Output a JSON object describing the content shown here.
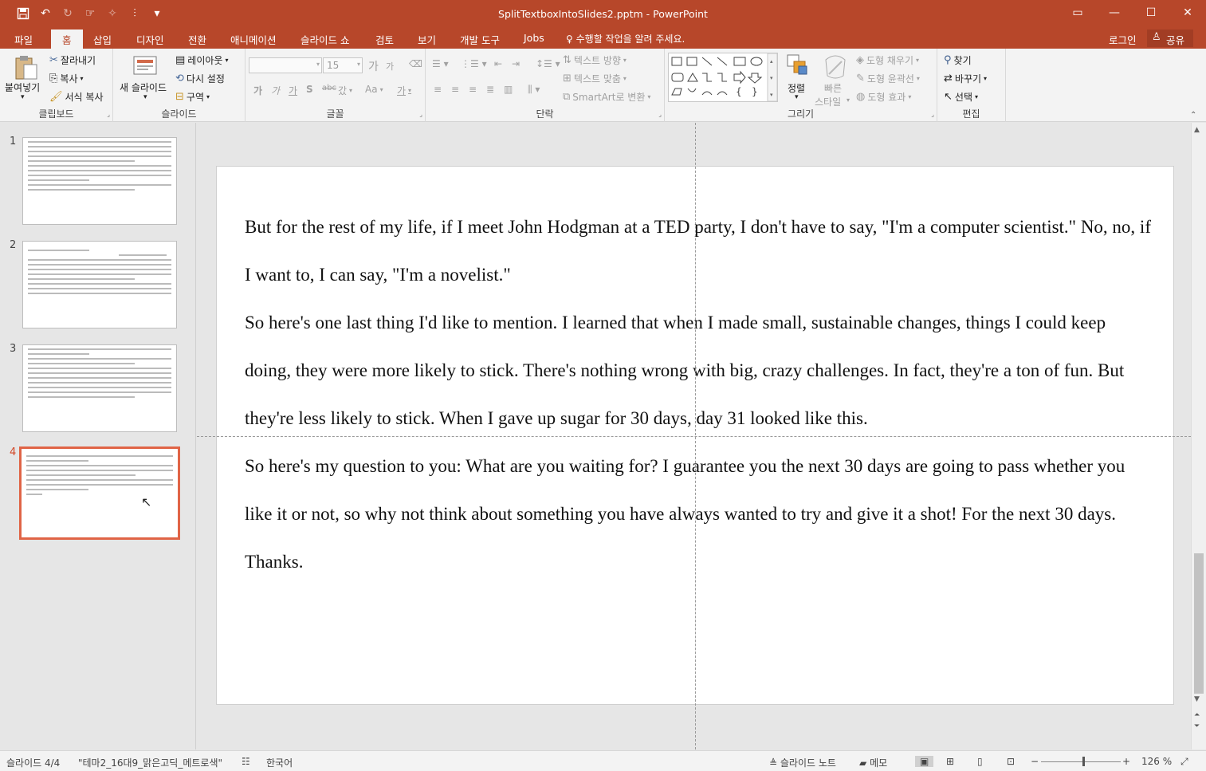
{
  "window": {
    "title": "SplitTextboxIntoSlides2.pptm - PowerPoint",
    "controls": [
      "ribbon-display-icon",
      "minimize-icon",
      "maximize-icon",
      "close-icon"
    ]
  },
  "quick_access": [
    "save-icon",
    "undo-icon",
    "redo-icon",
    "customize-icon"
  ],
  "tabs": [
    "파일",
    "홈",
    "삽입",
    "디자인",
    "전환",
    "애니메이션",
    "슬라이드 쇼",
    "검토",
    "보기",
    "개발 도구",
    "Jobs"
  ],
  "active_tab": "홈",
  "tell_me": "수행할 작업을 알려 주세요.",
  "login": "로그인",
  "share": "공유",
  "ribbon": {
    "clipboard": {
      "label": "클립보드",
      "paste": "붙여넣기",
      "cut": "잘라내기",
      "copy": "복사",
      "format_painter": "서식 복사"
    },
    "slides": {
      "label": "슬라이드",
      "new_slide": "새 슬라이드",
      "layout": "레이아웃",
      "reset": "다시 설정",
      "section": "구역"
    },
    "font": {
      "label": "글꼴",
      "font_name": "",
      "font_size": "15",
      "grow": "가",
      "shrink": "가",
      "bold": "가",
      "italic": "가",
      "underline": "가",
      "shadow": "S",
      "strike": "abc",
      "spacing": "갔",
      "case": "Aa",
      "color": "가"
    },
    "paragraph": {
      "label": "단락",
      "text_direction": "텍스트 방향",
      "align_text": "텍스트 맞춤",
      "smartart": "SmartArt로 변환"
    },
    "drawing": {
      "label": "그리기",
      "arrange": "정렬",
      "quick_styles_1": "빠른",
      "quick_styles_2": "스타일",
      "shape_fill": "도형 채우기",
      "shape_outline": "도형 윤곽선",
      "shape_effects": "도형 효과"
    },
    "editing": {
      "label": "편집",
      "find": "찾기",
      "replace": "바꾸기",
      "select": "선택"
    }
  },
  "thumbnails": [
    {
      "number": "1"
    },
    {
      "number": "2"
    },
    {
      "number": "3"
    },
    {
      "number": "4"
    }
  ],
  "selected_slide": "4",
  "slide": {
    "paragraphs": [
      "But for the rest of my life, if I meet John Hodgman at a TED party, I don't have to say, \"I'm a computer scientist.\" No, no, if I want to, I can say, \"I'm a novelist.\"",
      "So here's one last thing I'd like to mention. I learned that when I made small, sustainable changes, things I could keep doing, they were more likely to stick. There's nothing wrong with big, crazy challenges. In fact, they're a ton of fun. But they're less likely to stick. When I gave up sugar for 30 days, day 31 looked like this.",
      "So here's my question to you: What are you waiting for? I guarantee you the next 30 days are going to pass whether you like it or not, so why not think about something you have always wanted to try and give it a shot! For the next 30 days.",
      "Thanks."
    ]
  },
  "status": {
    "slide_count": "슬라이드 4/4",
    "theme": "\"테마2_16대9_맑은고딕_메트로색\"",
    "language": "한국어",
    "notes": "슬라이드 노트",
    "comments": "메모",
    "zoom": "126 %"
  },
  "colors": {
    "accent": "#b7472a",
    "selected_thumb": "#e06446"
  }
}
